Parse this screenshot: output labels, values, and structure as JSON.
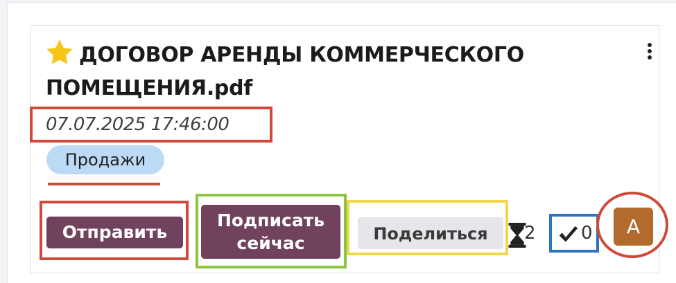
{
  "card": {
    "title": "ДОГОВОР АРЕНДЫ КОММЕРЧЕСКОГО ПОМЕЩЕНИЯ.pdf",
    "date": "07.07.2025 17:46:00",
    "tag": "Продажи",
    "icons": {
      "favorite": "star-icon",
      "more": "kebab-menu-icon",
      "pending": "hourglass-icon",
      "done": "checkmark-icon"
    }
  },
  "actions": {
    "send_label": "Отправить",
    "sign_line1": "Подписать",
    "sign_line2": "сейчас",
    "share_label": "Поделиться"
  },
  "status": {
    "pending_count": "2",
    "done_count": "0"
  },
  "avatar": {
    "initial": "А"
  },
  "colors": {
    "primary": "#71425c",
    "tag_bg": "#bcd9f6",
    "avatar_bg": "#b36b2d",
    "star": "#f5c518",
    "highlight_red": "#d04a3a",
    "highlight_green": "#8bc43f",
    "highlight_yellow": "#f1d54b",
    "highlight_blue": "#2c74c2"
  }
}
